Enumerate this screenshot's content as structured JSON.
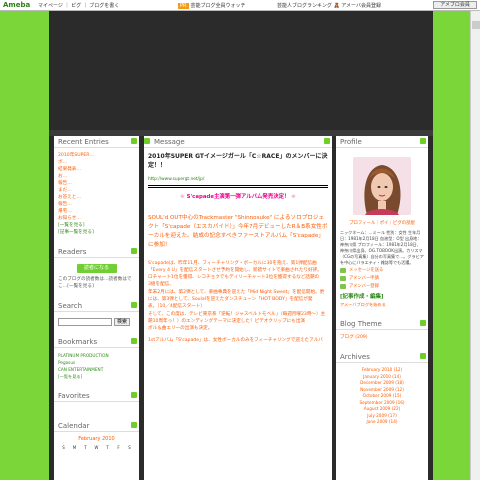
{
  "topbar": {
    "logo": "Ameba",
    "nav": "マイページ ｜ ピグ ｜ ブログを書く",
    "promo1_tag": "PR",
    "promo1": "芸能ブログ全員ウォッチ",
    "promo2": "芸能人ブログランキング 🧸 アメーバ会員登録",
    "login": "アメブロ会員"
  },
  "left": {
    "recent": {
      "title": "Recent Entries",
      "items": [
        "2010年SUPER…",
        "ボ…",
        "結果発表…",
        "お…",
        "報告…",
        "まだ…",
        "お答えと…",
        "報告…",
        "帰宅…",
        "お知らせ…",
        "遠征…"
      ],
      "more": [
        "[一覧を見る]",
        "[記事一覧を見る]"
      ]
    },
    "readers": {
      "title": "Readers",
      "button": "読者になる",
      "text": "このブログの読者数は…読者数はでこ…[一覧を見る]"
    },
    "search": {
      "title": "Search",
      "button": "検索"
    },
    "bookmarks": {
      "title": "Bookmarks",
      "items": [
        "PLATINUM PRODUCTION",
        "Pegasus",
        "CAN ENTERTAINMENT",
        "[一覧を見る]"
      ]
    },
    "favorites": {
      "title": "Favorites"
    },
    "calendar": {
      "title": "Calendar",
      "month": "February 2010",
      "days": [
        "S",
        "M",
        "T",
        "W",
        "T",
        "F",
        "S"
      ]
    }
  },
  "main": {
    "header": "Message",
    "title": "2010年SUPER GTイメージガール「C☆RACE」のメンバーに決定！！",
    "link": "http://www.supergt.net/jp/",
    "album": "S'capade主演第一弾アルバム発売決定！",
    "lead": "SOUL'd OUT中心のTrackmaster \"Shinnosuke\" によるソロプロジェクト「S'capade（エスカパイド）」今年7月デビューしたR＆B系女性ボーカルを迎えた。結成の記念すべきファーストアルバム「S'capade」に参加！",
    "body": [
      "S'capadeは、昨年11月、フィーチャリング・ボーカルに30を抱え、第1弾配信曲",
      "「Every 4 U」を配信スタートさせ予約を開始し、新譜サイトで楽曲されたり好評。",
      "ロチャート1位を獲得、レコチョクでもデイリーチャート3位を獲得するなど話題の",
      "3組を配信、",
      "年末2月には、第2弾として、楽曲事典を迎えた「Mid Night Sweet」を配信開始。更",
      "には、第3弾として、SoulaIを迎えたダンスチューン「HOT BODY」を配信が発",
      "表。（10／4配信スタート）",
      "そして、この度は、テレビ東京系「逆転！ジャスベルトモベル」（毎週月曜23時〜）主",
      "題10周年っ！）のエンディングテーマに決定した！ピデオクリップにも出演",
      "ボル＆曲エリーの出演も決定。",
      "",
      "1stアルバム「S'capade」は、女性ボーカルのみをフィーチャリングで迎えたアルバ"
    ]
  },
  "right": {
    "profile": {
      "title": "Profile",
      "name": "プロフィール｜ポイ｜ピグの部屋",
      "text": "ニックネーム：…ミール 性別：女性 生年月日：1981年2月18日 血液型：O型 出身地：神奈川県 プロフィール：1981年2月18日、神奈川県出身。OG.TOBOOK出演。カリスマ（CGの写真集）自分の写真集で…。グラビアを中心にバラエティ・雑誌等でも活躍。",
      "links": [
        "メッセージを送る",
        "アメンバー申請",
        "アメンバー登録"
      ],
      "reg_link": "[記事作成・編集]",
      "reg_sub": "アメーバブログを始める"
    },
    "theme": {
      "title": "Blog Theme",
      "item": "ブログ (209)"
    },
    "archives": {
      "title": "Archives",
      "items": [
        "February 2010 (12)",
        "January 2010 (14)",
        "December 2009 (18)",
        "November 2009 (12)",
        "October 2009 (15)",
        "September 2009 (16)",
        "August 2009 (22)",
        "July 2009 (17)",
        "June 2009 (14)"
      ]
    }
  }
}
